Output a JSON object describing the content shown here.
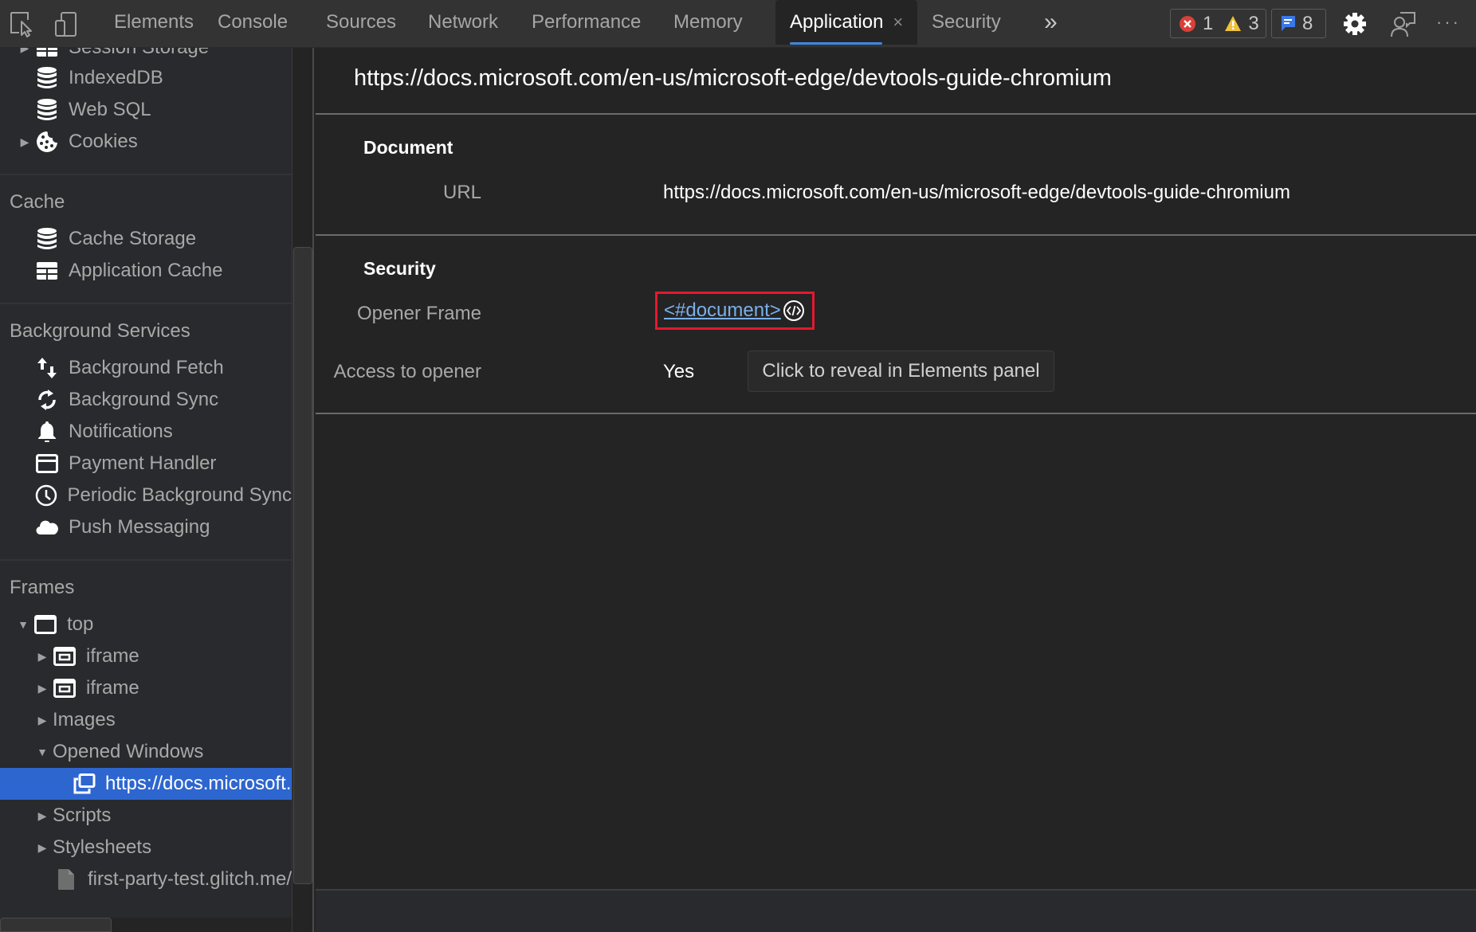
{
  "toolbar": {
    "tabs": [
      {
        "label": "Elements"
      },
      {
        "label": "Console"
      },
      {
        "label": "Sources"
      },
      {
        "label": "Network"
      },
      {
        "label": "Performance"
      },
      {
        "label": "Memory"
      },
      {
        "label": "Application",
        "active": true
      },
      {
        "label": "Security"
      }
    ],
    "close_glyph": "×",
    "more_tabs_glyph": "»",
    "counters": {
      "errors": "1",
      "warnings": "3",
      "messages": "8"
    },
    "more_menu_glyph": "···"
  },
  "sidebar": {
    "storage_items": [
      {
        "label": "Session Storage",
        "icon": "table-icon",
        "expandable": true
      },
      {
        "label": "IndexedDB",
        "icon": "database-icon"
      },
      {
        "label": "Web SQL",
        "icon": "database-icon"
      },
      {
        "label": "Cookies",
        "icon": "cookie-icon",
        "expandable": true
      }
    ],
    "cache": {
      "header": "Cache",
      "items": [
        {
          "label": "Cache Storage",
          "icon": "database-icon"
        },
        {
          "label": "Application Cache",
          "icon": "table-icon"
        }
      ]
    },
    "background_services": {
      "header": "Background Services",
      "items": [
        {
          "label": "Background Fetch",
          "icon": "arrows-up-down-icon"
        },
        {
          "label": "Background Sync",
          "icon": "sync-icon"
        },
        {
          "label": "Notifications",
          "icon": "bell-icon"
        },
        {
          "label": "Payment Handler",
          "icon": "credit-card-icon"
        },
        {
          "label": "Periodic Background Sync",
          "icon": "clock-icon"
        },
        {
          "label": "Push Messaging",
          "icon": "cloud-icon"
        }
      ]
    },
    "frames": {
      "header": "Frames",
      "top": "top",
      "children": [
        {
          "label": "iframe",
          "icon": "iframe-icon"
        },
        {
          "label": "iframe",
          "icon": "iframe-icon"
        },
        {
          "label": "Images"
        },
        {
          "label": "Opened Windows"
        },
        {
          "label": "https://docs.microsoft.com/en-us/microsoft-edge/devtools-guide-chromium",
          "icon": "window-icon",
          "selected": true
        },
        {
          "label": "Scripts"
        },
        {
          "label": "Stylesheets"
        },
        {
          "label": "first-party-test.glitch.me/",
          "icon": "file-icon"
        }
      ]
    }
  },
  "main": {
    "title": "https://docs.microsoft.com/en-us/microsoft-edge/devtools-guide-chromium",
    "document": {
      "heading": "Document",
      "url_label": "URL",
      "url_value": "https://docs.microsoft.com/en-us/microsoft-edge/devtools-guide-chromium"
    },
    "security": {
      "heading": "Security",
      "opener_frame_label": "Opener Frame",
      "opener_frame_value": "<#document>",
      "access_label": "Access to opener",
      "access_value": "Yes",
      "reveal_button": "Click to reveal in Elements panel"
    }
  },
  "colors": {
    "accent": "#3f86e0",
    "selection": "#2e66d0",
    "highlight_box": "#e5182f",
    "link": "#7ab0ea",
    "error": "#d9403a",
    "warning": "#f0c13a",
    "message": "#3b78e7"
  }
}
